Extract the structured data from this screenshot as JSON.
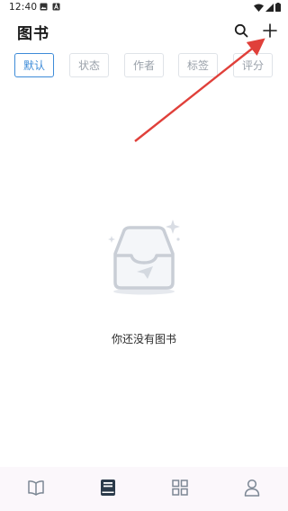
{
  "status_bar": {
    "time": "12:40"
  },
  "header": {
    "title": "图书",
    "search_icon": "search-icon",
    "add_icon": "plus-icon"
  },
  "sort_options": [
    {
      "label": "默认",
      "active": true
    },
    {
      "label": "状态",
      "active": false
    },
    {
      "label": "作者",
      "active": false
    },
    {
      "label": "标签",
      "active": false
    },
    {
      "label": "评分",
      "active": false
    }
  ],
  "empty_state": {
    "icon": "empty-box-icon",
    "message": "你还没有图书"
  },
  "bottom_nav": [
    {
      "name": "reading",
      "icon": "open-book-icon",
      "active": false
    },
    {
      "name": "books",
      "icon": "book-icon",
      "active": true
    },
    {
      "name": "categories",
      "icon": "grid-icon",
      "active": false
    },
    {
      "name": "profile",
      "icon": "person-icon",
      "active": false
    }
  ],
  "colors": {
    "accent": "#3d8bd8",
    "chip_border": "#dfe3e8",
    "chip_text": "#9aa1aa",
    "nav_background": "#fbf7fb",
    "annotation_arrow": "#e0403a"
  }
}
